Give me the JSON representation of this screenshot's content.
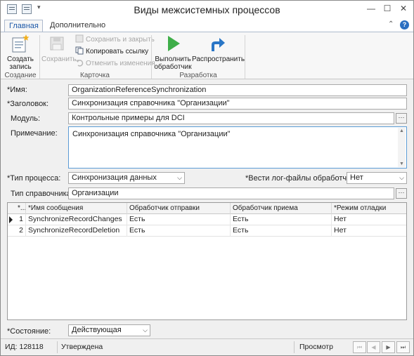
{
  "window": {
    "title": "Виды межсистемных процессов"
  },
  "ribbon": {
    "tabs": [
      "Главная",
      "Дополнительно"
    ],
    "groups": {
      "create": {
        "label": "Создание",
        "create_button": "Создать запись"
      },
      "card": {
        "label": "Карточка",
        "save": "Сохранить",
        "save_close": "Сохранить и закрыть",
        "copy_link": "Копировать ссылку",
        "undo": "Отменить изменения"
      },
      "dev": {
        "label": "Разработка",
        "run_handler": "Выполнить обработчик",
        "distribute": "Распространить"
      }
    },
    "colors": {
      "run_icon": "#3fae49",
      "distribute_icon": "#2a76c6"
    }
  },
  "form": {
    "name_label": "*Имя:",
    "name_value": "OrganizationReferenceSynchronization",
    "title_label": "*Заголовок:",
    "title_value": "Синхронизация справочника \"Организации\"",
    "module_label": "Модуль:",
    "module_value": "Контрольные примеры для DCI",
    "note_label": "Примечание:",
    "note_value": "Синхронизация справочника \"Организации\"",
    "process_type_label": "*Тип процесса:",
    "process_type_value": "Синхронизация данных",
    "log_files_label": "*Вести лог-файлы обработчиков:",
    "log_files_value": "Нет",
    "ref_type_label": "Тип справочника:",
    "ref_type_value": "Организации",
    "state_label": "*Состояние:",
    "state_value": "Действующая",
    "ellipsis": "···"
  },
  "grid": {
    "columns": [
      "*...",
      "*Имя сообщения",
      "Обработчик отправки",
      "Обработчик приема",
      "*Режим отладки"
    ],
    "rows": [
      {
        "num": "1",
        "name": "SynchronizeRecordChanges",
        "send": "Есть",
        "receive": "Есть",
        "debug": "Нет"
      },
      {
        "num": "2",
        "name": "SynchronizeRecordDeletion",
        "send": "Есть",
        "receive": "Есть",
        "debug": "Нет"
      }
    ]
  },
  "status": {
    "id_text": "ИД: 128118",
    "approval": "Утверждена",
    "mode": "Просмотр"
  }
}
